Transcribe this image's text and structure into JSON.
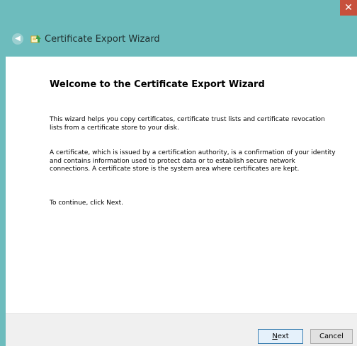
{
  "window": {
    "title": "Certificate Export Wizard",
    "close_glyph": "✕",
    "back_glyph": "◀",
    "icons": [
      "back-arrow-icon",
      "certificate-icon",
      "close-icon"
    ]
  },
  "wizard": {
    "heading": "Welcome to the Certificate Export Wizard",
    "paragraph1": "This wizard helps you copy certificates, certificate trust lists and certificate revocation\nlists from a certificate store to your disk.",
    "paragraph2": "A certificate, which is issued by a certification authority, is a confirmation of your identity\nand contains information used to protect data or to establish secure network\nconnections. A certificate store is the system area where certificates are kept.",
    "paragraph3": "To continue, click Next."
  },
  "footer": {
    "next_label_accel": "N",
    "next_label_rest": "ext",
    "cancel_label": "Cancel"
  },
  "colors": {
    "frame": "#6dbcbd",
    "close_button": "#c7503c",
    "content_bg": "#ffffff",
    "footer_bg": "#f0f0f0"
  }
}
